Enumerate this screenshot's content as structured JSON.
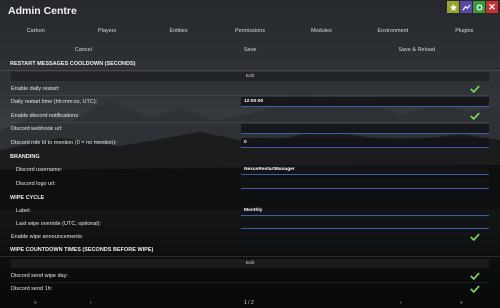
{
  "window": {
    "title": "Admin Centre"
  },
  "window_buttons": [
    {
      "icon": "star-icon",
      "color": "#9aa22a"
    },
    {
      "icon": "chart-icon",
      "color": "#5a4aa8"
    },
    {
      "icon": "gear-icon",
      "color": "#3b9a3b"
    },
    {
      "icon": "close-icon",
      "color": "#c83232",
      "label": "✕"
    }
  ],
  "nav": [
    "Carbon",
    "Players",
    "Entities",
    "Permissions",
    "Modules",
    "Environment",
    "Plugins"
  ],
  "actions": {
    "cancel": "Cancel",
    "save": "Save",
    "save_reload": "Save & Reload"
  },
  "restart": {
    "title": "RESTART MESSAGES COOLDOWN (SECONDS)",
    "edit": "Edit",
    "daily_restart_label": "Enable daily restart:",
    "daily_restart_checked": true,
    "daily_restart_time_label": "Daily restart time (hh:mm:ss, UTC):",
    "daily_restart_time_value": "12:00:00",
    "discord_notifications_label": "Enable discord notifications:",
    "discord_notifications_checked": true,
    "webhook_label": "Discord webhook url:",
    "webhook_value": "",
    "role_label": "Discord role id to mention (0 = no mention):",
    "role_value": "0"
  },
  "branding": {
    "title": "BRANDING",
    "username_label": "Discord username:",
    "username_value": "NexusRestartManager",
    "logo_label": "Discord logo url:",
    "logo_value": ""
  },
  "wipe": {
    "title": "WIPE CYCLE",
    "label_label": "Label:",
    "label_value": "Monthly",
    "override_label": "Last wipe override (UTC, optional):",
    "override_value": "",
    "announcements_label": "Enable wipe announcements:",
    "announcements_checked": true
  },
  "wipe_countdown": {
    "title": "WIPE COUNTDOWN TIMES (SECONDS BEFORE WIPE)",
    "edit": "Edit",
    "wipe_day_label": "Discord send wipe day:",
    "wipe_day_checked": true,
    "send_1h_label": "Discord send 1h:",
    "send_1h_checked": true
  },
  "pager": {
    "prev": "«",
    "prev_one": "‹",
    "page": "1 / 2",
    "next_one": "›",
    "next": "»"
  },
  "colors": {
    "accent": "#3e5ca8",
    "check": "#7ed957"
  }
}
